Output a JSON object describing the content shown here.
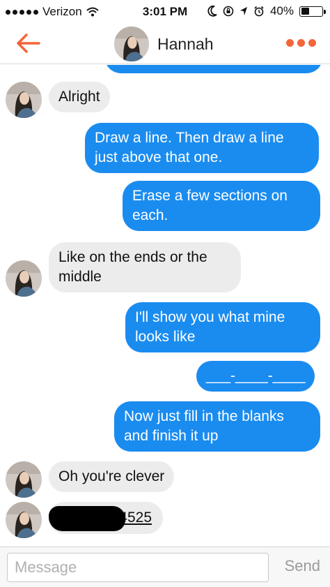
{
  "status_bar": {
    "carrier": "Verizon",
    "time": "3:01 PM",
    "battery": "40%",
    "battery_level": 0.4
  },
  "header": {
    "name": "Hannah",
    "accent_color": "#f4653a"
  },
  "messages": [
    {
      "from": "them",
      "text": "Alright"
    },
    {
      "from": "me",
      "text": "Draw a line. Then draw a line just above that one."
    },
    {
      "from": "me",
      "text": "Erase a few sections on each."
    },
    {
      "from": "them",
      "text": "Like on the ends or the middle"
    },
    {
      "from": "me",
      "text": "I'll show you what mine looks like"
    },
    {
      "from": "me",
      "text": "___-____-____"
    },
    {
      "from": "me",
      "text": "Now just fill in the blanks and finish it up"
    },
    {
      "from": "them",
      "text": "Oh you're clever"
    },
    {
      "from": "them",
      "text": "4525",
      "redacted_prefix": true
    }
  ],
  "composer": {
    "placeholder": "Message",
    "send_label": "Send"
  },
  "colors": {
    "outgoing_bubble": "#1a8cf0",
    "incoming_bubble": "#ececec"
  }
}
